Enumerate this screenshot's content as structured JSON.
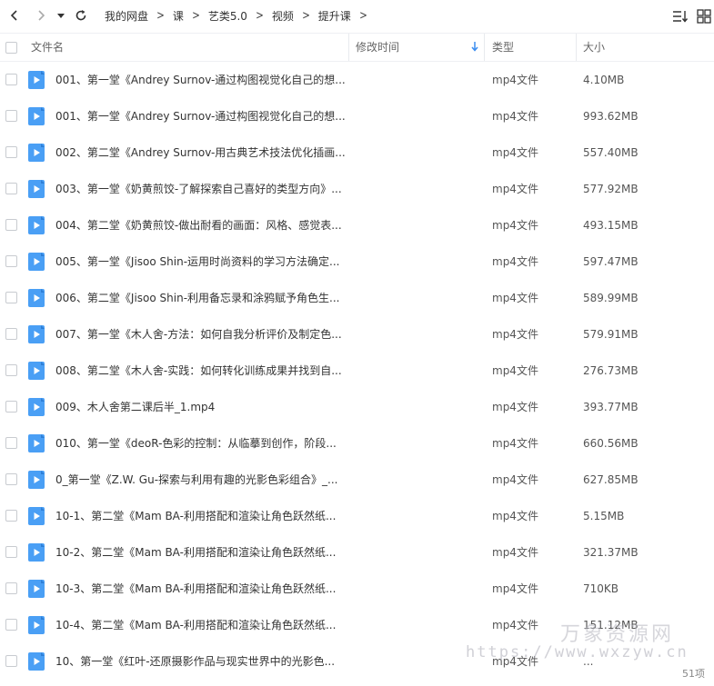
{
  "nav": {
    "back_icon": "chevron-left-icon",
    "forward_icon": "chevron-right-icon",
    "dropdown_icon": "caret-down-icon",
    "refresh_icon": "refresh-icon"
  },
  "breadcrumb": [
    "我的网盘",
    "课",
    "艺类5.0",
    "视频",
    "提升课"
  ],
  "toolbar": {
    "sort_icon": "sort-list-icon",
    "grid_icon": "grid-view-icon"
  },
  "columns": {
    "name": "文件名",
    "mtime": "修改时间",
    "type": "类型",
    "size": "大小"
  },
  "files": [
    {
      "name": "001、第一堂《Andrey Surnov-通过构图视觉化自己的想...",
      "type": "mp4文件",
      "size": "4.10MB"
    },
    {
      "name": "001、第一堂《Andrey Surnov-通过构图视觉化自己的想...",
      "type": "mp4文件",
      "size": "993.62MB"
    },
    {
      "name": "002、第二堂《Andrey Surnov-用古典艺术技法优化插画...",
      "type": "mp4文件",
      "size": "557.40MB"
    },
    {
      "name": "003、第一堂《奶黄煎饺-了解探索自己喜好的类型方向》...",
      "type": "mp4文件",
      "size": "577.92MB"
    },
    {
      "name": "004、第二堂《奶黄煎饺-做出耐看的画面：风格、感觉表...",
      "type": "mp4文件",
      "size": "493.15MB"
    },
    {
      "name": "005、第一堂《Jisoo Shin-运用时尚资料的学习方法确定...",
      "type": "mp4文件",
      "size": "597.47MB"
    },
    {
      "name": "006、第二堂《Jisoo Shin-利用备忘录和涂鸦赋予角色生...",
      "type": "mp4文件",
      "size": "589.99MB"
    },
    {
      "name": "007、第一堂《木人舍-方法：如何自我分析评价及制定色...",
      "type": "mp4文件",
      "size": "579.91MB"
    },
    {
      "name": "008、第二堂《木人舍-实践：如何转化训练成果并找到自...",
      "type": "mp4文件",
      "size": "276.73MB"
    },
    {
      "name": "009、木人舍第二课后半_1.mp4",
      "type": "mp4文件",
      "size": "393.77MB"
    },
    {
      "name": "010、第一堂《deoR-色彩的控制：从临摹到创作，阶段...",
      "type": "mp4文件",
      "size": "660.56MB"
    },
    {
      "name": "0_第一堂《Z.W. Gu-探索与利用有趣的光影色彩组合》_...",
      "type": "mp4文件",
      "size": "627.85MB"
    },
    {
      "name": "10-1、第二堂《Mam BA-利用搭配和渲染让角色跃然纸...",
      "type": "mp4文件",
      "size": "5.15MB"
    },
    {
      "name": "10-2、第二堂《Mam BA-利用搭配和渲染让角色跃然纸...",
      "type": "mp4文件",
      "size": "321.37MB"
    },
    {
      "name": "10-3、第二堂《Mam BA-利用搭配和渲染让角色跃然纸...",
      "type": "mp4文件",
      "size": "710KB"
    },
    {
      "name": "10-4、第二堂《Mam BA-利用搭配和渲染让角色跃然纸...",
      "type": "mp4文件",
      "size": "151.12MB"
    },
    {
      "name": "10、第一堂《红叶-还原摄影作品与现实世界中的光影色...",
      "type": "mp4文件",
      "size": "..."
    }
  ],
  "item_count": "51项",
  "watermark": {
    "line1": "万象资源网",
    "line2": "https://www.wxzyw.cn"
  },
  "colors": {
    "video_icon": "#4a9ff5",
    "sort_arrow": "#3b8df0"
  }
}
